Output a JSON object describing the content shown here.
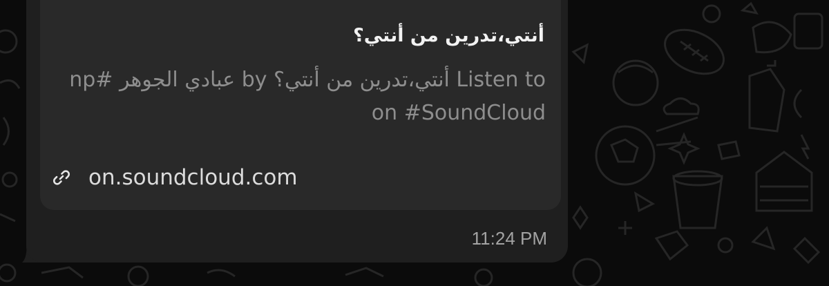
{
  "message": {
    "link_preview": {
      "title": "أنتي،تدرين من أنتي؟",
      "description": "Listen to أنتي،تدرين من أنتي؟ by عبادي الجوهر #np on #SoundCloud",
      "domain": "on.soundcloud.com",
      "icon": "link-icon"
    },
    "timestamp": "11:24 PM"
  },
  "colors": {
    "background": "#0b0b0b",
    "bubble": "#1f1f1f",
    "preview_card": "#292929",
    "title_text": "#f2f2f2",
    "description_text": "#8e8e8e",
    "timestamp_text": "#a3a3a3"
  }
}
